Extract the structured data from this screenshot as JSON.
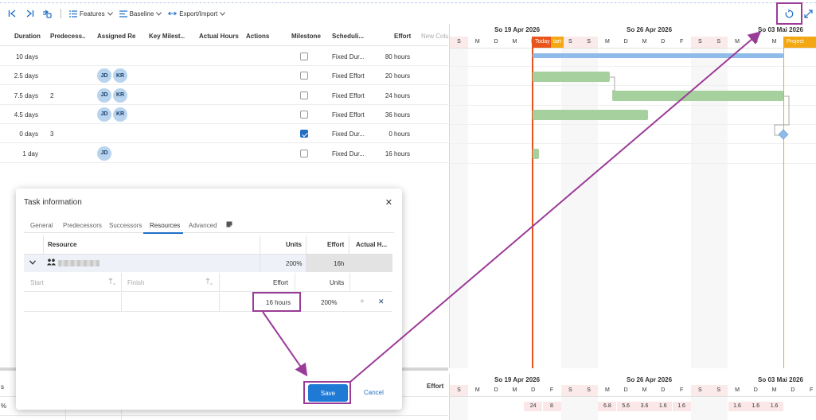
{
  "toolbar": {
    "features_label": "Features",
    "baseline_label": "Baseline",
    "export_label": "Export/Import"
  },
  "grid": {
    "columns": [
      "Duration",
      "Predecess...",
      "Assigned Re...",
      "Key Milest...",
      "Actual Hours",
      "Actions",
      "Milestone",
      "Scheduli...",
      "Effort",
      "New Colu"
    ],
    "rows": [
      {
        "duration": "10 days",
        "pred": "",
        "resources": [],
        "milestone": false,
        "sched": "Fixed Dur...",
        "effort": "80 hours"
      },
      {
        "duration": "2.5 days",
        "pred": "",
        "resources": [
          "JD",
          "KR"
        ],
        "milestone": false,
        "sched": "Fixed Effort",
        "effort": "20 hours"
      },
      {
        "duration": "7.5 days",
        "pred": "2",
        "resources": [
          "JD",
          "KR"
        ],
        "milestone": false,
        "sched": "Fixed Effort",
        "effort": "24 hours"
      },
      {
        "duration": "4.5 days",
        "pred": "",
        "resources": [
          "JD",
          "KR"
        ],
        "milestone": false,
        "sched": "Fixed Effort",
        "effort": "36 hours"
      },
      {
        "duration": "0 days",
        "pred": "3",
        "resources": [],
        "milestone": true,
        "sched": "Fixed Dur...",
        "effort": "0 hours"
      },
      {
        "duration": "1 day",
        "pred": "",
        "resources": [
          "JD"
        ],
        "milestone": false,
        "sched": "Fixed Dur...",
        "effort": "16 hours"
      }
    ]
  },
  "gantt": {
    "weeks": [
      "So 19 Apr 2026",
      "So 26 Apr 2026",
      "So 03 Mai 2026"
    ],
    "days": [
      "S",
      "M",
      "D",
      "M",
      "D",
      "F",
      "S",
      "S",
      "M",
      "D",
      "M",
      "D",
      "F",
      "S",
      "S",
      "M",
      "D",
      "M",
      "D",
      "F"
    ],
    "today_label": "Today",
    "today_tail": "tart",
    "project_end_label": "Project end"
  },
  "lower": {
    "left_label": "Effort",
    "left_stub_top": "s",
    "left_stub_bottom": "%",
    "days": [
      "S",
      "M",
      "D",
      "M",
      "D",
      "F",
      "S",
      "S",
      "M",
      "D",
      "M",
      "D",
      "F",
      "S",
      "S",
      "M",
      "D",
      "M",
      "D",
      "F"
    ],
    "values": [
      "",
      "",
      "",
      "",
      "24",
      "8",
      "",
      "",
      "6.8",
      "5.6",
      "3.6",
      "1.6",
      "1.6",
      "",
      "",
      "1.6",
      "1.6",
      "1.6",
      "",
      ""
    ]
  },
  "dialog": {
    "title": "Task information",
    "tabs": [
      "General",
      "Predecessors",
      "Successors",
      "Resources",
      "Advanced"
    ],
    "active_tab": "Resources",
    "table_headers": {
      "resource": "Resource",
      "units": "Units",
      "effort": "Effort",
      "actual": "Actual H..."
    },
    "resource_row": {
      "units": "200%",
      "effort": "16h"
    },
    "sub_headers": {
      "start": "Start",
      "finish": "Finish",
      "effort": "Effort",
      "units": "Units"
    },
    "sub_row": {
      "effort": "16 hours",
      "units": "200%"
    },
    "save_label": "Save",
    "cancel_label": "Cancel"
  },
  "colors": {
    "accent": "#1f6fc5",
    "today": "#e8541c",
    "project_end": "#f3a712",
    "bar": "#a6d19e",
    "summary": "#8fbbe9",
    "annotation": "#9b3b98"
  }
}
